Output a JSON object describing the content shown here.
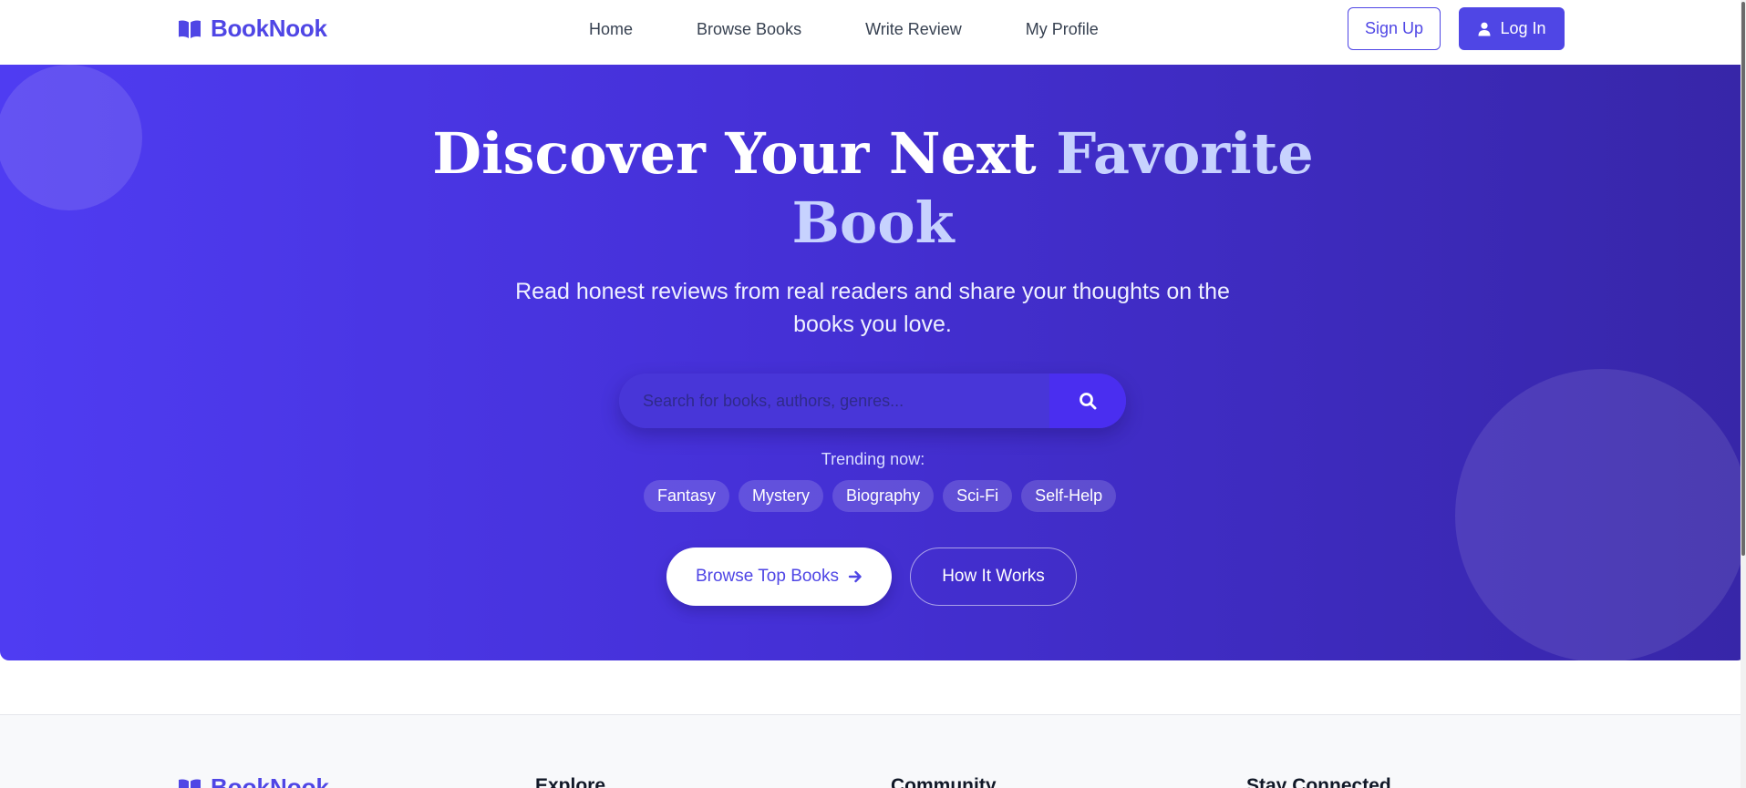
{
  "brand": {
    "name": "BookNook",
    "icon": "open-book-icon",
    "color": "#4f46e5"
  },
  "nav": {
    "links": [
      "Home",
      "Browse Books",
      "Write Review",
      "My Profile"
    ],
    "signup_label": "Sign Up",
    "login_label": "Log In",
    "login_icon": "user-icon"
  },
  "hero": {
    "title_main": "Discover Your Next ",
    "title_accent": "Favorite Book",
    "subtitle": "Read honest reviews from real readers and share your thoughts on the books you love.",
    "search": {
      "placeholder": "Search for books, authors, genres...",
      "value": "",
      "icon": "search-icon"
    },
    "trending_label": "Trending now:",
    "trending_tags": [
      "Fantasy",
      "Mystery",
      "Biography",
      "Sci-Fi",
      "Self-Help"
    ],
    "primary_cta": "Browse Top Books",
    "primary_cta_icon": "arrow-right-icon",
    "secondary_cta": "How It Works",
    "gradient_start": "#4f3cf2",
    "gradient_end": "#3726a8"
  },
  "footer": {
    "brand": "BookNook",
    "columns": [
      "Explore",
      "Community",
      "Stay Connected"
    ]
  }
}
